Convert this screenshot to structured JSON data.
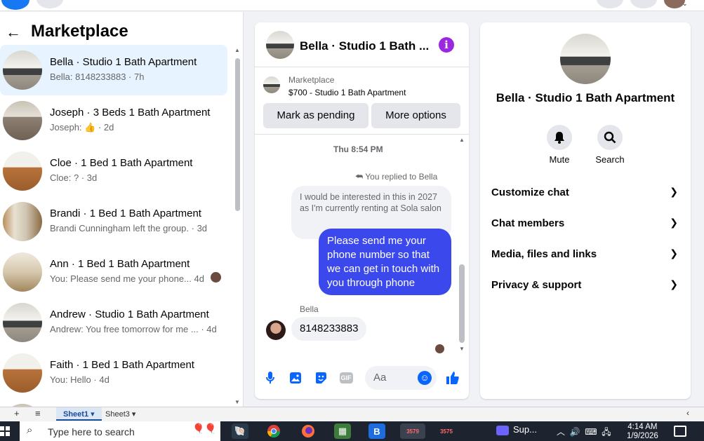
{
  "page": {
    "title": "Marketplace"
  },
  "conversations": [
    {
      "title": "Bella · Studio 1 Bath Apartment",
      "subtitle": "Bella: 8148233883 · 7h",
      "thumb": "kitchen",
      "active": true
    },
    {
      "title": "Joseph · 3 Beds 1 Bath Apartment",
      "subtitle": "Joseph: 👍 · 2d",
      "thumb": "room",
      "active": false
    },
    {
      "title": "Cloe · 1 Bed 1 Bath Apartment",
      "subtitle": "Cloe: ? · 3d",
      "thumb": "wood",
      "active": false
    },
    {
      "title": "Brandi · 1 Bed 1 Bath Apartment",
      "subtitle": "Brandi Cunningham left the group. · 3d",
      "thumb": "shelf",
      "active": false
    },
    {
      "title": "Ann · 1 Bed 1 Bath Apartment",
      "subtitle": "You: Please send me your phone... 4d",
      "thumb": "ann",
      "active": false
    },
    {
      "title": "Andrew · Studio 1 Bath Apartment",
      "subtitle": "Andrew: You free tomorrow for me ... · 4d",
      "thumb": "kitchen",
      "active": false
    },
    {
      "title": "Faith · 1 Bed 1 Bath Apartment",
      "subtitle": "You: Hello · 4d",
      "thumb": "wood",
      "active": false
    }
  ],
  "chat": {
    "title": "Bella · Studio 1 Bath ...",
    "listing_label": "Marketplace",
    "listing_price": "$700 - Studio 1 Bath Apartment",
    "btn_pending": "Mark as pending",
    "btn_more": "More options",
    "timestamp": "Thu 8:54 PM",
    "replied_label": "You replied to Bella",
    "quoted_text": "I would be interested in this in 2027 as I'm currently renting at Sola salon",
    "sent_text": "Please send me your phone  number so that we can get in touch with you through phone",
    "sender_name": "Bella",
    "received_text": "8148233883",
    "input_placeholder": "Aa"
  },
  "right": {
    "title": "Bella · Studio 1 Bath Apartment",
    "mute_label": "Mute",
    "search_label": "Search",
    "rows": [
      "Customize chat",
      "Chat members",
      "Media, files and links",
      "Privacy & support"
    ]
  },
  "sheets": {
    "sheet1": "Sheet1",
    "sheet3": "Sheet3"
  },
  "taskbar": {
    "search_placeholder": "Type here to search",
    "app_label": "Sup...",
    "time": "4:14 AM",
    "date": "1/9/2026",
    "badge1": "3579",
    "badge2": "3575"
  },
  "colors": {
    "accent": "#0866ff",
    "sent_bubble": "#3b49ec",
    "info_icon": "#9c27e0",
    "active_row": "#e7f3ff"
  }
}
